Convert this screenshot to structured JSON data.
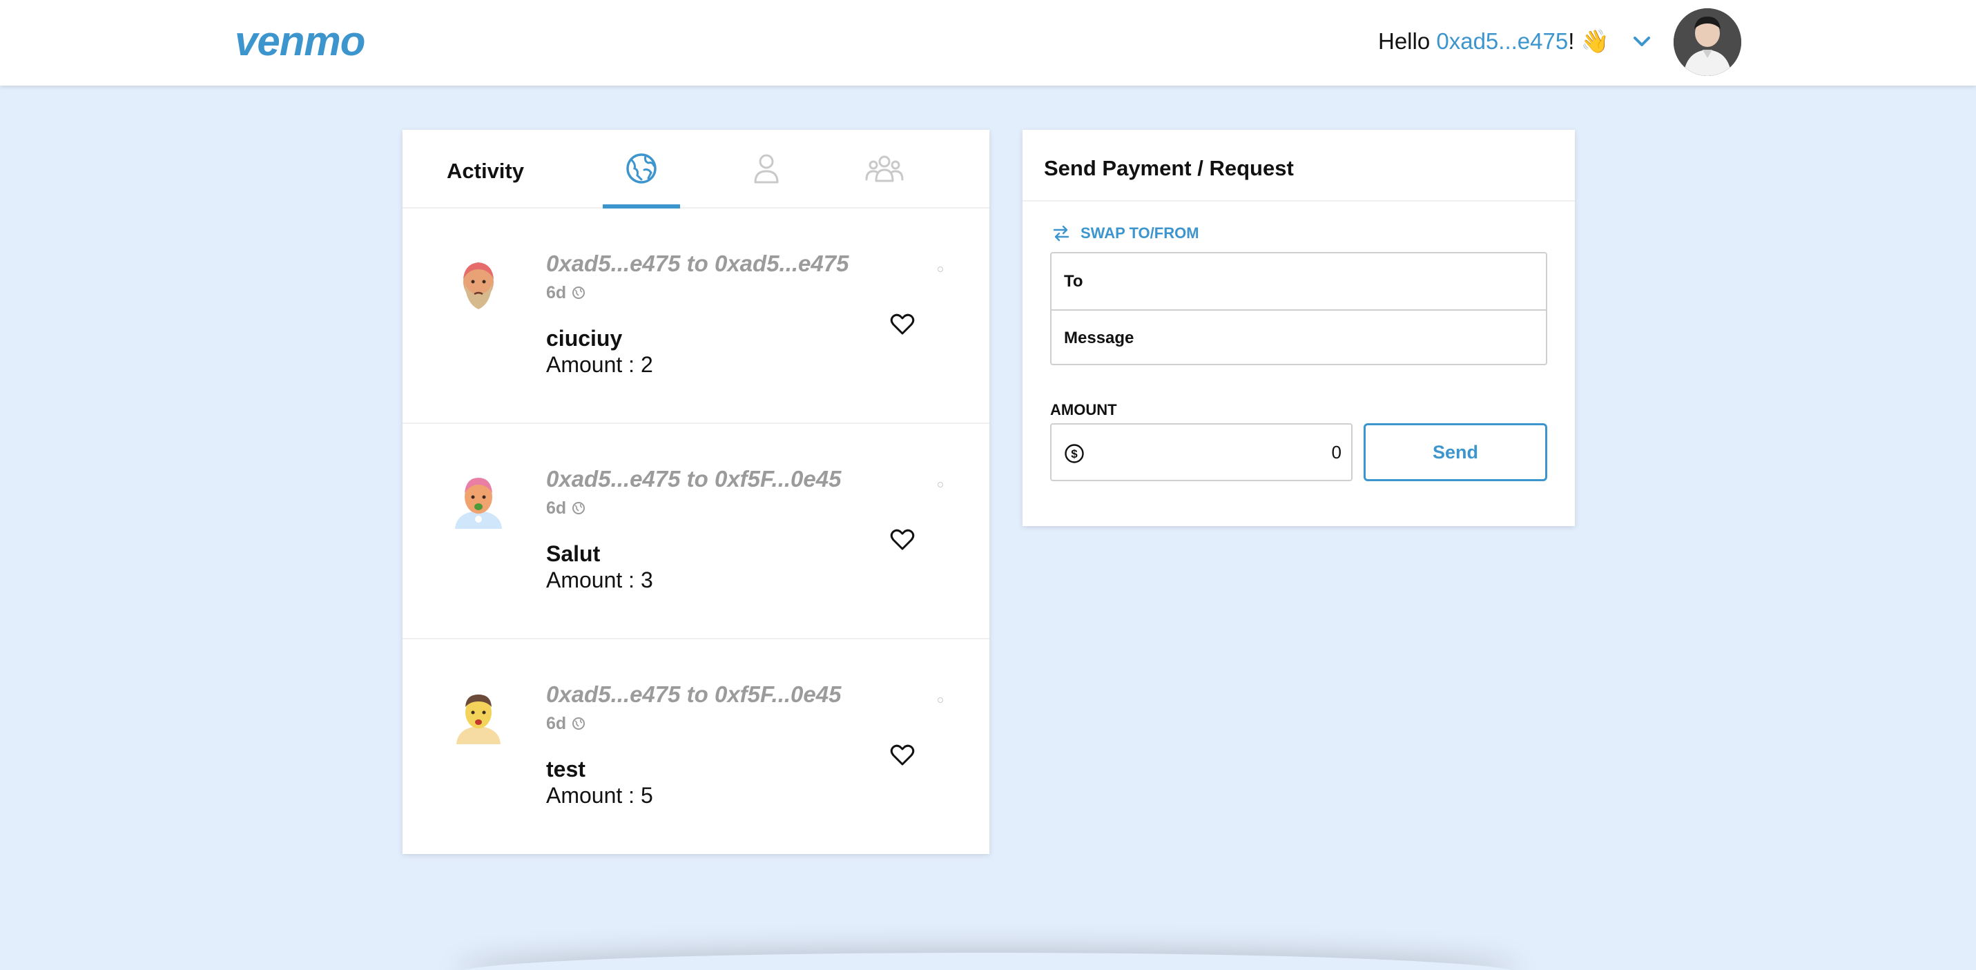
{
  "header": {
    "logo": "venmo",
    "greeting_prefix": "Hello ",
    "address": "0xad5...e475",
    "greeting_suffix": "! 👋"
  },
  "activity": {
    "title": "Activity",
    "tabs": [
      {
        "name": "global",
        "active": true
      },
      {
        "name": "personal",
        "active": false
      },
      {
        "name": "friends",
        "active": false
      }
    ],
    "items": [
      {
        "parties": "0xad5...e475 to 0xad5...e475",
        "time": "6d",
        "message": "ciuciuy",
        "amount": "Amount : 2"
      },
      {
        "parties": "0xad5...e475 to 0xf5F...0e45",
        "time": "6d",
        "message": "Salut",
        "amount": "Amount : 3"
      },
      {
        "parties": "0xad5...e475 to 0xf5F...0e45",
        "time": "6d",
        "message": "test",
        "amount": "Amount : 5"
      }
    ]
  },
  "send": {
    "title": "Send Payment / Request",
    "swap_label": "SWAP TO/FROM",
    "to_placeholder": "To",
    "message_placeholder": "Message",
    "amount_label": "AMOUNT",
    "amount_value": "0",
    "send_label": "Send"
  },
  "colors": {
    "brand": "#3d95ce",
    "background": "#e3eefc",
    "muted_text": "#9b9b9b"
  }
}
